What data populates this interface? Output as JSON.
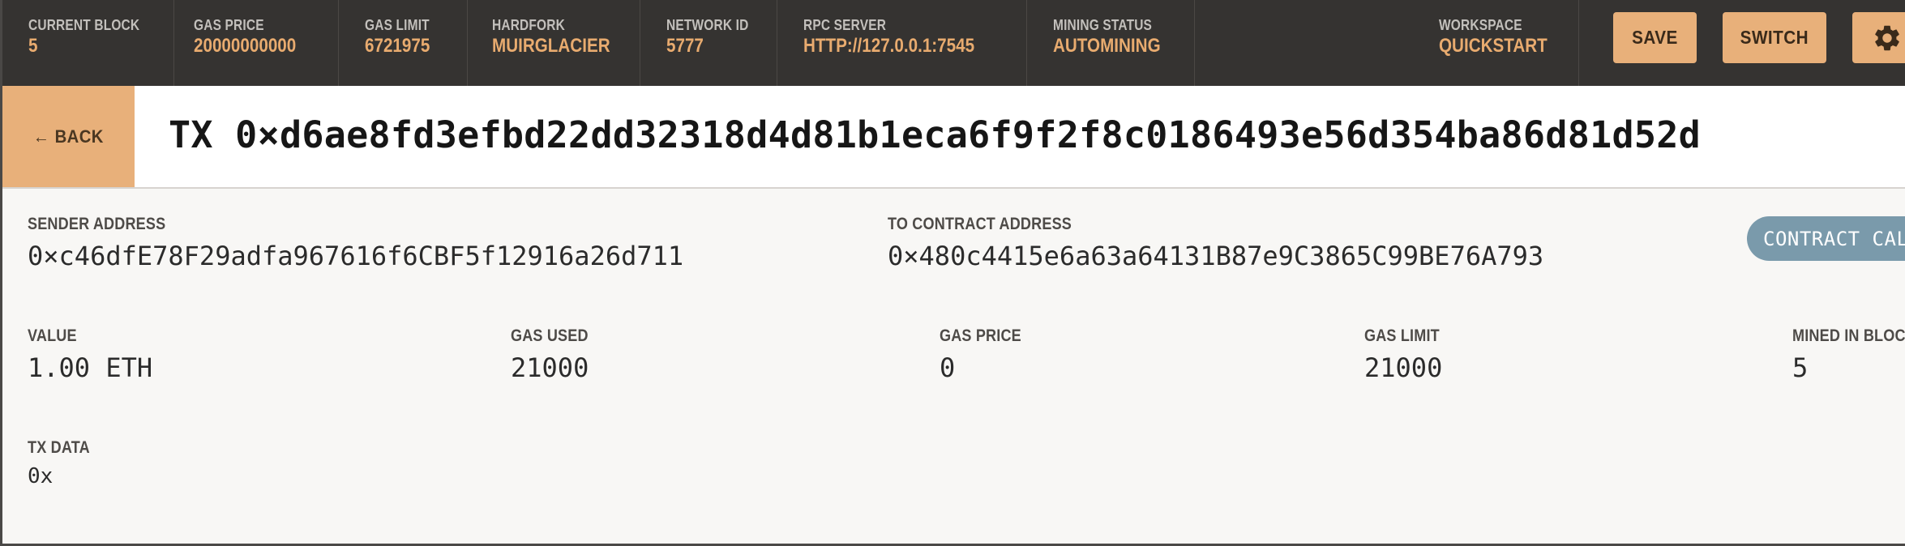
{
  "topbar": {
    "stats": [
      {
        "label": "CURRENT BLOCK",
        "value": "5"
      },
      {
        "label": "GAS PRICE",
        "value": "20000000000"
      },
      {
        "label": "GAS LIMIT",
        "value": "6721975"
      },
      {
        "label": "HARDFORK",
        "value": "MUIRGLACIER"
      },
      {
        "label": "NETWORK ID",
        "value": "5777"
      },
      {
        "label": "RPC SERVER",
        "value": "HTTP://127.0.0.1:7545"
      },
      {
        "label": "MINING STATUS",
        "value": "AUTOMINING"
      }
    ],
    "workspace": {
      "label": "WORKSPACE",
      "value": "QUICKSTART"
    },
    "save_label": "SAVE",
    "switch_label": "SWITCH",
    "settings_icon": "gear-icon"
  },
  "tx": {
    "back_label": "← BACK",
    "title": "TX 0×d6ae8fd3efbd22dd32318d4d81b1eca6f9f2f8c0186493e56d354ba86d81d52d",
    "sender": {
      "label": "SENDER ADDRESS",
      "value": "0×c46dfE78F29adfa967616f6CBF5f12916a26d711"
    },
    "to_contract": {
      "label": "TO CONTRACT ADDRESS",
      "value": "0×480c4415e6a63a64131B87e9C3865C99BE76A793"
    },
    "badge": "CONTRACT CALL",
    "value": {
      "label": "VALUE",
      "value": "1.00 ETH"
    },
    "gas_used": {
      "label": "GAS USED",
      "value": "21000"
    },
    "gas_price": {
      "label": "GAS PRICE",
      "value": "0"
    },
    "gas_limit": {
      "label": "GAS LIMIT",
      "value": "21000"
    },
    "mined_in_block": {
      "label": "MINED IN BLOCK",
      "value": "5"
    },
    "tx_data": {
      "label": "TX DATA",
      "value": "0x"
    }
  },
  "colors": {
    "topbar_bg": "#353331",
    "accent": "#e8b07a",
    "stat_value": "#e8ab6f",
    "badge_bg": "#7a9aab"
  }
}
